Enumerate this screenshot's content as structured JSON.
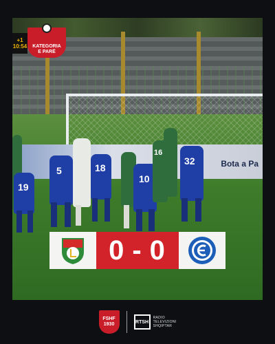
{
  "broadcast": {
    "badge_line1": "KATEGORIA",
    "badge_line2": "E PARË",
    "clock_prefix": "+1",
    "clock_time": "10:54",
    "board_text": "Bota a Pa"
  },
  "players": {
    "n1": "5",
    "n2": "18",
    "n3": "19",
    "n4": "10",
    "n5": "32",
    "n6": "16"
  },
  "score": {
    "home": "0",
    "separator": "-",
    "away": "0"
  },
  "footer": {
    "fshf_label": "FSHF",
    "fshf_year": "1930",
    "rtsh_mark": "RTSH",
    "rtsh_line1": "RADIO",
    "rtsh_line2": "TELEVIZIONI",
    "rtsh_line3": "SHQIPTAR"
  },
  "colors": {
    "score_red": "#d3232a",
    "badge_red": "#c91d2a",
    "home_kit": "#1f3fa6"
  }
}
